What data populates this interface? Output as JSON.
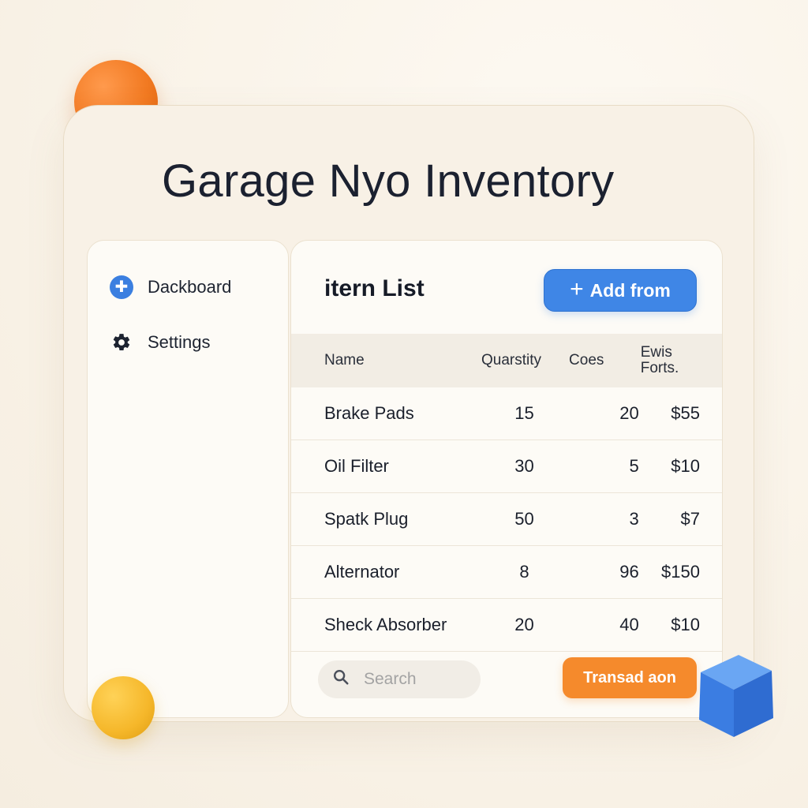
{
  "app": {
    "title": "Garage Nyo Inventory"
  },
  "sidebar": {
    "items": [
      {
        "label": "Dackboard",
        "icon": "dashboard-icon"
      },
      {
        "label": "Settings",
        "icon": "gear-icon"
      }
    ]
  },
  "main": {
    "title": "itern List",
    "add_button": {
      "plus": "+",
      "label": "Add from"
    },
    "table": {
      "headers": {
        "name": "Name",
        "quantity": "Quarstity",
        "cost": "Coes",
        "price_line1": "Ewis",
        "price_line2": "Forts."
      },
      "rows": [
        {
          "name": "Brake Pads",
          "quantity": "15",
          "cost": "20",
          "price": "$55"
        },
        {
          "name": "Oil Filter",
          "quantity": "30",
          "cost": "5",
          "price": "$10"
        },
        {
          "name": "Spatk Plug",
          "quantity": "50",
          "cost": "3",
          "price": "$7"
        },
        {
          "name": "Alternator",
          "quantity": "8",
          "cost": "96",
          "price": "$150"
        },
        {
          "name": "Sheck Absorber",
          "quantity": "20",
          "cost": "40",
          "price": "$10"
        }
      ]
    },
    "search": {
      "placeholder": "Search"
    },
    "transaction_button": {
      "label": "Transad aon"
    }
  },
  "colors": {
    "accent_blue": "#3f86e6",
    "accent_orange": "#f58a2c",
    "accent_yellow": "#f5b72a"
  }
}
